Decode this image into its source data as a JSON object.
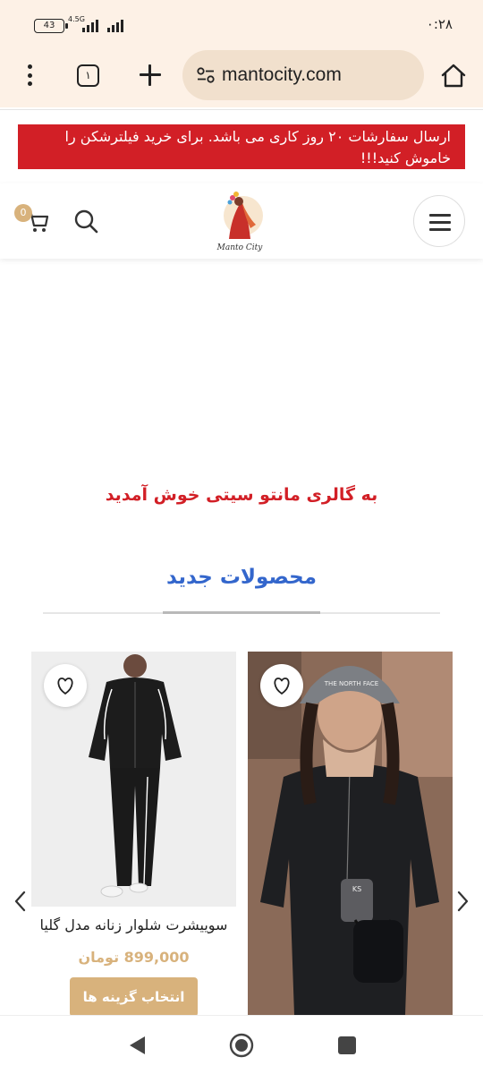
{
  "status_bar": {
    "time": "۰:۲۸",
    "battery": "43",
    "network": "4.5G"
  },
  "browser": {
    "tab_count": "۱",
    "url": "mantocity.com"
  },
  "notice": {
    "text": "ارسال سفارشات ۲۰ روز کاری می باشد. برای خرید فیلترشکن را خاموش کنید!!!"
  },
  "header": {
    "cart_count": "0",
    "logo_text": "Manto City"
  },
  "welcome": {
    "text": "به گالری مانتو سیتی خوش آمدید"
  },
  "section": {
    "title": "محصولات جدید"
  },
  "products": [
    {
      "name": "سوییشرت شلوار زنانه مدل گلیا",
      "price": "899,000 تومان",
      "button": "انتخاب گزینه ها"
    },
    {
      "cap_text": "THE NORTH FACE",
      "phone_text": "KS"
    }
  ],
  "colors": {
    "accent_gold": "#d8b27c",
    "notice_red": "#d21f26",
    "title_blue": "#3366cc"
  }
}
